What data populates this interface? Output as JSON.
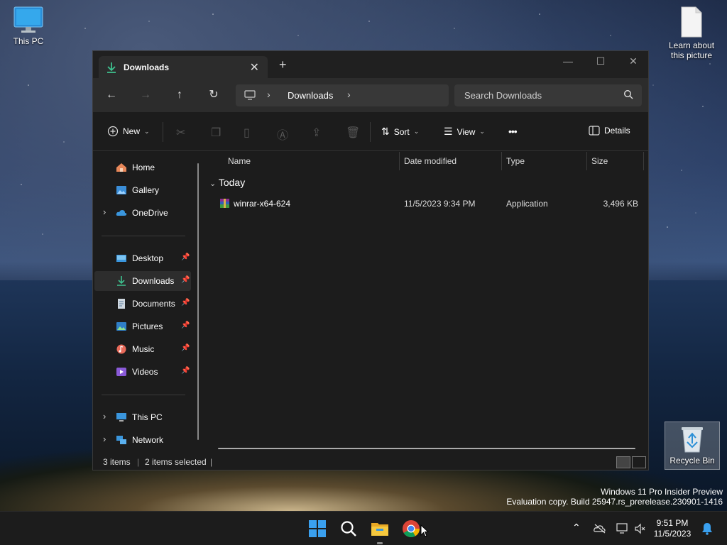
{
  "desktop": {
    "icons": [
      {
        "label": "This PC"
      },
      {
        "label": "Learn about this picture"
      },
      {
        "label": "Recycle Bin"
      }
    ],
    "watermark": {
      "line1": "Windows 11 Pro Insider Preview",
      "line2": "Evaluation copy. Build 25947.rs_prerelease.230901-1416"
    }
  },
  "window": {
    "tab_title": "Downloads",
    "new_tab": "+",
    "address": {
      "crumb": "Downloads"
    },
    "search": {
      "placeholder": "Search Downloads"
    },
    "commands": {
      "new_label": "New",
      "sort_label": "Sort",
      "view_label": "View",
      "more_label": "•••",
      "details_label": "Details"
    },
    "sidebar": {
      "items": [
        {
          "label": "Home"
        },
        {
          "label": "Gallery"
        },
        {
          "label": "OneDrive"
        },
        {
          "label": "Desktop"
        },
        {
          "label": "Downloads"
        },
        {
          "label": "Documents"
        },
        {
          "label": "Pictures"
        },
        {
          "label": "Music"
        },
        {
          "label": "Videos"
        },
        {
          "label": "This PC"
        },
        {
          "label": "Network"
        }
      ]
    },
    "columns": [
      "Name",
      "Date modified",
      "Type",
      "Size"
    ],
    "group_label": "Today",
    "files": [
      {
        "name": "winrar-x64-624",
        "date": "11/5/2023 9:34 PM",
        "type": "Application",
        "size": "3,496 KB"
      }
    ],
    "status": {
      "items": "3 items",
      "selected": "2 items selected"
    }
  },
  "taskbar": {
    "time": "9:51 PM",
    "date": "11/5/2023"
  },
  "colors": {
    "window_bg": "#1c1c1c",
    "accent_download": "#3ec28f",
    "taskbar_bg": "#1c1c1c"
  }
}
